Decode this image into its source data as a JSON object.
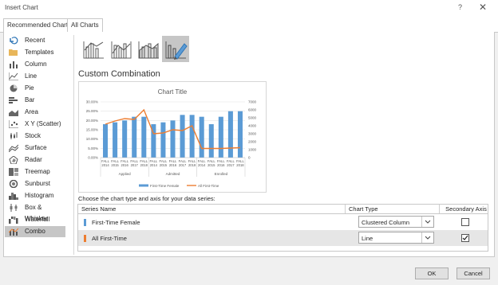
{
  "window": {
    "title": "Insert Chart",
    "help": "?",
    "close": "✕"
  },
  "tabs": [
    "Recommended Charts",
    "All Charts"
  ],
  "sidebar": {
    "items": [
      {
        "label": "Recent",
        "icon": "recent-icon"
      },
      {
        "label": "Templates",
        "icon": "folder-icon"
      },
      {
        "label": "Column",
        "icon": "column-chart-icon"
      },
      {
        "label": "Line",
        "icon": "line-chart-icon"
      },
      {
        "label": "Pie",
        "icon": "pie-chart-icon"
      },
      {
        "label": "Bar",
        "icon": "bar-chart-icon"
      },
      {
        "label": "Area",
        "icon": "area-chart-icon"
      },
      {
        "label": "X Y (Scatter)",
        "icon": "scatter-chart-icon"
      },
      {
        "label": "Stock",
        "icon": "stock-chart-icon"
      },
      {
        "label": "Surface",
        "icon": "surface-chart-icon"
      },
      {
        "label": "Radar",
        "icon": "radar-chart-icon"
      },
      {
        "label": "Treemap",
        "icon": "treemap-icon"
      },
      {
        "label": "Sunburst",
        "icon": "sunburst-icon"
      },
      {
        "label": "Histogram",
        "icon": "histogram-icon"
      },
      {
        "label": "Box & Whisker",
        "icon": "box-whisker-icon"
      },
      {
        "label": "Waterfall",
        "icon": "waterfall-icon"
      },
      {
        "label": "Combo",
        "icon": "combo-chart-icon"
      }
    ],
    "selected": "Combo"
  },
  "subtypes": [
    "clustered-column-line-icon",
    "clustered-column-line-secondary-icon",
    "stacked-area-column-icon",
    "custom-combination-icon"
  ],
  "section_title": "Custom Combination",
  "choose_label": "Choose the chart type and axis for your data series:",
  "table": {
    "headers": [
      "Series Name",
      "Chart Type",
      "Secondary Axis"
    ],
    "rows": [
      {
        "name": "First-Time Female",
        "color": "#5b9bd5",
        "type": "Clustered Column",
        "secondary": false
      },
      {
        "name": "All First-Time",
        "color": "#ed7d31",
        "type": "Line",
        "secondary": true
      }
    ]
  },
  "buttons": {
    "ok": "OK",
    "cancel": "Cancel"
  },
  "chart_data": {
    "type": "bar",
    "title": "Chart Title",
    "categories": [
      "FALL 2014",
      "FALL 2015",
      "FALL 2016",
      "FALL 2017",
      "FALL 2018",
      "FALL 2014",
      "FALL 2015",
      "FALL 2016",
      "FALL 2017",
      "FALL 2018",
      "FALL 2014",
      "FALL 2015",
      "FALL 2016",
      "FALL 2017",
      "FALL 2018"
    ],
    "groups": [
      "Applied",
      "Admitted",
      "Enrolled"
    ],
    "series": [
      {
        "name": "First-Time Female",
        "chart": "column",
        "axis": "primary",
        "color": "#5b9bd5",
        "values": [
          0.18,
          0.19,
          0.2,
          0.22,
          0.22,
          0.18,
          0.19,
          0.2,
          0.23,
          0.23,
          0.22,
          0.18,
          0.22,
          0.25,
          0.25
        ]
      },
      {
        "name": "All First-Time",
        "chart": "line",
        "axis": "secondary",
        "color": "#ed7d31",
        "values": [
          4200,
          4600,
          4900,
          4800,
          6000,
          3000,
          3100,
          3500,
          3400,
          4000,
          1150,
          1150,
          1150,
          1200,
          1250
        ]
      }
    ],
    "y_ticks": [
      "30.00%",
      "25.00%",
      "20.00%",
      "15.00%",
      "10.00%",
      "5.00%",
      "0.00%"
    ],
    "y2_ticks": [
      "7000",
      "6000",
      "5000",
      "4000",
      "3000",
      "2000",
      "1000",
      "0"
    ],
    "ylim": [
      0,
      0.3
    ],
    "y2lim": [
      0,
      7000
    ],
    "legend_position": "bottom"
  }
}
